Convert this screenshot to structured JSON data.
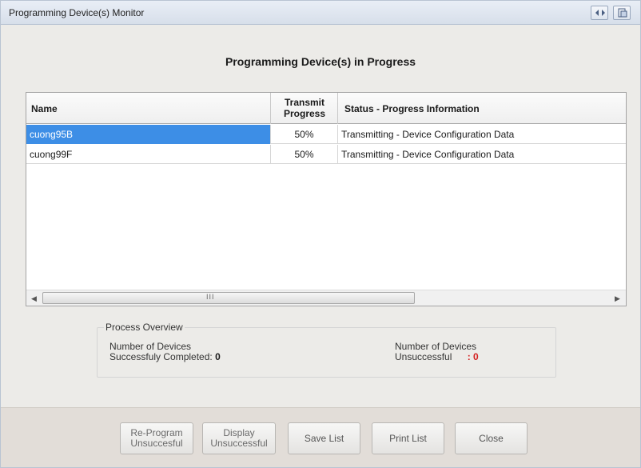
{
  "window": {
    "title": "Programming Device(s) Monitor"
  },
  "heading": "Programming Device(s) in Progress",
  "table": {
    "columns": {
      "name": "Name",
      "transmit_line1": "Transmit",
      "transmit_line2": "Progress",
      "status": "Status - Progress Information"
    },
    "rows": [
      {
        "name": "cuong95B",
        "progress": "50%",
        "status": "Transmitting - Device Configuration Data",
        "selected": true
      },
      {
        "name": "cuong99F",
        "progress": "50%",
        "status": "Transmitting - Device Configuration Data",
        "selected": false
      }
    ]
  },
  "overview": {
    "legend": "Process Overview",
    "completed_line1": "Number of Devices",
    "completed_line2": "Successfuly Completed:",
    "completed_value": "0",
    "unsuccessful_line1": "Number of Devices",
    "unsuccessful_line2": "Unsuccessful",
    "unsuccessful_value": ": 0"
  },
  "buttons": {
    "reprogram_line1": "Re-Program",
    "reprogram_line2": "Unsuccesful",
    "display_line1": "Display",
    "display_line2": "Unsuccessful",
    "save": "Save List",
    "print": "Print List",
    "close": "Close"
  },
  "colors": {
    "selection": "#3d8ee6",
    "unsuccessful_value": "#d42020"
  }
}
